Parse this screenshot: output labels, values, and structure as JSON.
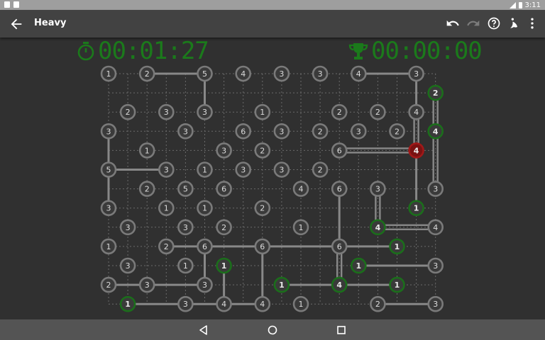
{
  "status_bar": {
    "time": "3:11"
  },
  "toolbar": {
    "title": "Heavy",
    "icons": [
      "arrow-back-icon",
      "undo-icon",
      "redo-icon",
      "help-icon",
      "theme-icon",
      "more-vert-icon"
    ]
  },
  "timers": {
    "elapsed": "00:01:27",
    "best": "00:00:00"
  },
  "colors": {
    "background": "#303030",
    "node_fill": "#3a3a3a",
    "node_ring": "#7a7a7a",
    "node_done_ring": "#1b6e1b",
    "node_error_fill": "#7a1212",
    "node_error_ring": "#a01818",
    "bridge": "#888888",
    "timer": "#1b7a1b"
  },
  "board": {
    "cols": 18,
    "rows": 13,
    "islands": [
      {
        "r": 0,
        "c": 0,
        "v": "1",
        "s": "n"
      },
      {
        "r": 0,
        "c": 2,
        "v": "2",
        "s": "n"
      },
      {
        "r": 0,
        "c": 5,
        "v": "5",
        "s": "n"
      },
      {
        "r": 0,
        "c": 7,
        "v": "4",
        "s": "n"
      },
      {
        "r": 0,
        "c": 9,
        "v": "3",
        "s": "n"
      },
      {
        "r": 0,
        "c": 11,
        "v": "3",
        "s": "n"
      },
      {
        "r": 0,
        "c": 13,
        "v": "4",
        "s": "n"
      },
      {
        "r": 0,
        "c": 16,
        "v": "3",
        "s": "n"
      },
      {
        "r": 1,
        "c": 17,
        "v": "2",
        "s": "d"
      },
      {
        "r": 2,
        "c": 1,
        "v": "2",
        "s": "n"
      },
      {
        "r": 2,
        "c": 3,
        "v": "3",
        "s": "n"
      },
      {
        "r": 2,
        "c": 5,
        "v": "3",
        "s": "n"
      },
      {
        "r": 2,
        "c": 8,
        "v": "1",
        "s": "n"
      },
      {
        "r": 2,
        "c": 12,
        "v": "2",
        "s": "n"
      },
      {
        "r": 2,
        "c": 14,
        "v": "2",
        "s": "n"
      },
      {
        "r": 2,
        "c": 16,
        "v": "4",
        "s": "n"
      },
      {
        "r": 3,
        "c": 0,
        "v": "3",
        "s": "n"
      },
      {
        "r": 3,
        "c": 4,
        "v": "3",
        "s": "n"
      },
      {
        "r": 3,
        "c": 7,
        "v": "6",
        "s": "n"
      },
      {
        "r": 3,
        "c": 9,
        "v": "3",
        "s": "n"
      },
      {
        "r": 3,
        "c": 11,
        "v": "2",
        "s": "n"
      },
      {
        "r": 3,
        "c": 13,
        "v": "3",
        "s": "n"
      },
      {
        "r": 3,
        "c": 15,
        "v": "2",
        "s": "n"
      },
      {
        "r": 3,
        "c": 17,
        "v": "4",
        "s": "d"
      },
      {
        "r": 4,
        "c": 2,
        "v": "1",
        "s": "n"
      },
      {
        "r": 4,
        "c": 6,
        "v": "3",
        "s": "n"
      },
      {
        "r": 4,
        "c": 8,
        "v": "2",
        "s": "n"
      },
      {
        "r": 4,
        "c": 12,
        "v": "6",
        "s": "n"
      },
      {
        "r": 4,
        "c": 16,
        "v": "4",
        "s": "e"
      },
      {
        "r": 5,
        "c": 0,
        "v": "5",
        "s": "n"
      },
      {
        "r": 5,
        "c": 3,
        "v": "3",
        "s": "n"
      },
      {
        "r": 5,
        "c": 5,
        "v": "1",
        "s": "n"
      },
      {
        "r": 5,
        "c": 7,
        "v": "3",
        "s": "n"
      },
      {
        "r": 5,
        "c": 9,
        "v": "3",
        "s": "n"
      },
      {
        "r": 5,
        "c": 11,
        "v": "2",
        "s": "n"
      },
      {
        "r": 6,
        "c": 2,
        "v": "2",
        "s": "n"
      },
      {
        "r": 6,
        "c": 4,
        "v": "5",
        "s": "n"
      },
      {
        "r": 6,
        "c": 6,
        "v": "6",
        "s": "n"
      },
      {
        "r": 6,
        "c": 10,
        "v": "4",
        "s": "n"
      },
      {
        "r": 6,
        "c": 12,
        "v": "6",
        "s": "n"
      },
      {
        "r": 6,
        "c": 14,
        "v": "3",
        "s": "n"
      },
      {
        "r": 6,
        "c": 17,
        "v": "3",
        "s": "n"
      },
      {
        "r": 7,
        "c": 0,
        "v": "3",
        "s": "n"
      },
      {
        "r": 7,
        "c": 3,
        "v": "1",
        "s": "n"
      },
      {
        "r": 7,
        "c": 5,
        "v": "1",
        "s": "n"
      },
      {
        "r": 7,
        "c": 8,
        "v": "2",
        "s": "n"
      },
      {
        "r": 7,
        "c": 16,
        "v": "1",
        "s": "d"
      },
      {
        "r": 8,
        "c": 1,
        "v": "3",
        "s": "n"
      },
      {
        "r": 8,
        "c": 4,
        "v": "3",
        "s": "n"
      },
      {
        "r": 8,
        "c": 6,
        "v": "2",
        "s": "n"
      },
      {
        "r": 8,
        "c": 10,
        "v": "1",
        "s": "n"
      },
      {
        "r": 8,
        "c": 14,
        "v": "4",
        "s": "d"
      },
      {
        "r": 8,
        "c": 17,
        "v": "4",
        "s": "n"
      },
      {
        "r": 9,
        "c": 0,
        "v": "1",
        "s": "n"
      },
      {
        "r": 9,
        "c": 3,
        "v": "2",
        "s": "n"
      },
      {
        "r": 9,
        "c": 5,
        "v": "6",
        "s": "n"
      },
      {
        "r": 9,
        "c": 8,
        "v": "6",
        "s": "n"
      },
      {
        "r": 9,
        "c": 12,
        "v": "6",
        "s": "n"
      },
      {
        "r": 9,
        "c": 15,
        "v": "1",
        "s": "d"
      },
      {
        "r": 10,
        "c": 1,
        "v": "3",
        "s": "n"
      },
      {
        "r": 10,
        "c": 4,
        "v": "1",
        "s": "n"
      },
      {
        "r": 10,
        "c": 6,
        "v": "1",
        "s": "d"
      },
      {
        "r": 10,
        "c": 13,
        "v": "1",
        "s": "d"
      },
      {
        "r": 10,
        "c": 17,
        "v": "3",
        "s": "n"
      },
      {
        "r": 11,
        "c": 0,
        "v": "2",
        "s": "n"
      },
      {
        "r": 11,
        "c": 2,
        "v": "3",
        "s": "n"
      },
      {
        "r": 11,
        "c": 5,
        "v": "3",
        "s": "n"
      },
      {
        "r": 11,
        "c": 9,
        "v": "1",
        "s": "d"
      },
      {
        "r": 11,
        "c": 12,
        "v": "4",
        "s": "d"
      },
      {
        "r": 11,
        "c": 15,
        "v": "1",
        "s": "d"
      },
      {
        "r": 12,
        "c": 1,
        "v": "1",
        "s": "d"
      },
      {
        "r": 12,
        "c": 4,
        "v": "3",
        "s": "n"
      },
      {
        "r": 12,
        "c": 6,
        "v": "4",
        "s": "n"
      },
      {
        "r": 12,
        "c": 8,
        "v": "4",
        "s": "n"
      },
      {
        "r": 12,
        "c": 10,
        "v": "1",
        "s": "n"
      },
      {
        "r": 12,
        "c": 14,
        "v": "2",
        "s": "n"
      },
      {
        "r": 12,
        "c": 17,
        "v": "3",
        "s": "n"
      }
    ],
    "bridges": [
      {
        "a": [
          0,
          2
        ],
        "b": [
          0,
          5
        ],
        "n": 1
      },
      {
        "a": [
          0,
          5
        ],
        "b": [
          2,
          5
        ],
        "n": 1
      },
      {
        "a": [
          0,
          13
        ],
        "b": [
          0,
          16
        ],
        "n": 1
      },
      {
        "a": [
          0,
          16
        ],
        "b": [
          2,
          16
        ],
        "n": 1
      },
      {
        "a": [
          2,
          16
        ],
        "b": [
          4,
          16
        ],
        "n": 2
      },
      {
        "a": [
          4,
          12
        ],
        "b": [
          4,
          16
        ],
        "n": 2
      },
      {
        "a": [
          4,
          16
        ],
        "b": [
          7,
          16
        ],
        "n": 1
      },
      {
        "a": [
          1,
          17
        ],
        "b": [
          3,
          17
        ],
        "n": 2
      },
      {
        "a": [
          3,
          17
        ],
        "b": [
          6,
          17
        ],
        "n": 2
      },
      {
        "a": [
          3,
          0
        ],
        "b": [
          5,
          0
        ],
        "n": 1
      },
      {
        "a": [
          5,
          0
        ],
        "b": [
          5,
          3
        ],
        "n": 1
      },
      {
        "a": [
          5,
          0
        ],
        "b": [
          7,
          0
        ],
        "n": 1
      },
      {
        "a": [
          6,
          12
        ],
        "b": [
          9,
          12
        ],
        "n": 1
      },
      {
        "a": [
          6,
          14
        ],
        "b": [
          8,
          14
        ],
        "n": 2
      },
      {
        "a": [
          8,
          14
        ],
        "b": [
          8,
          17
        ],
        "n": 2
      },
      {
        "a": [
          9,
          3
        ],
        "b": [
          9,
          5
        ],
        "n": 1
      },
      {
        "a": [
          9,
          5
        ],
        "b": [
          9,
          8
        ],
        "n": 1
      },
      {
        "a": [
          9,
          8
        ],
        "b": [
          9,
          12
        ],
        "n": 1
      },
      {
        "a": [
          9,
          12
        ],
        "b": [
          9,
          15
        ],
        "n": 1
      },
      {
        "a": [
          9,
          5
        ],
        "b": [
          11,
          5
        ],
        "n": 1
      },
      {
        "a": [
          9,
          8
        ],
        "b": [
          12,
          8
        ],
        "n": 1
      },
      {
        "a": [
          9,
          12
        ],
        "b": [
          11,
          12
        ],
        "n": 2
      },
      {
        "a": [
          10,
          6
        ],
        "b": [
          12,
          6
        ],
        "n": 1
      },
      {
        "a": [
          10,
          13
        ],
        "b": [
          10,
          17
        ],
        "n": 1
      },
      {
        "a": [
          11,
          0
        ],
        "b": [
          11,
          2
        ],
        "n": 1
      },
      {
        "a": [
          11,
          2
        ],
        "b": [
          11,
          5
        ],
        "n": 1
      },
      {
        "a": [
          11,
          9
        ],
        "b": [
          11,
          12
        ],
        "n": 1
      },
      {
        "a": [
          11,
          12
        ],
        "b": [
          11,
          15
        ],
        "n": 1
      },
      {
        "a": [
          12,
          1
        ],
        "b": [
          12,
          4
        ],
        "n": 1
      },
      {
        "a": [
          12,
          4
        ],
        "b": [
          12,
          6
        ],
        "n": 1
      },
      {
        "a": [
          12,
          6
        ],
        "b": [
          12,
          8
        ],
        "n": 1
      },
      {
        "a": [
          12,
          14
        ],
        "b": [
          12,
          17
        ],
        "n": 1
      }
    ]
  }
}
